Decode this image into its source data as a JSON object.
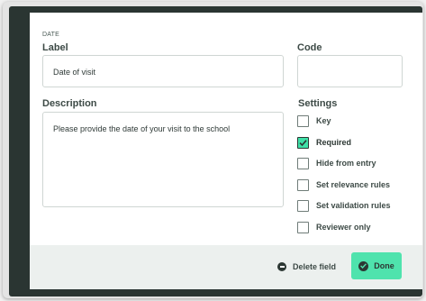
{
  "dialog": {
    "section_label": "DATE",
    "label": {
      "title": "Label",
      "value": "Date of visit"
    },
    "code": {
      "title": "Code",
      "value": ""
    },
    "description": {
      "title": "Description",
      "value": "Please provide the date of your visit to the school"
    },
    "settings": {
      "title": "Settings",
      "options": [
        {
          "label": "Key",
          "checked": false
        },
        {
          "label": "Required",
          "checked": true
        },
        {
          "label": "Hide from entry",
          "checked": false
        },
        {
          "label": "Set relevance rules",
          "checked": false
        },
        {
          "label": "Set validation rules",
          "checked": false
        },
        {
          "label": "Reviewer only",
          "checked": false
        }
      ]
    }
  },
  "footer": {
    "delete_label": "Delete field",
    "done_label": "Done"
  },
  "colors": {
    "backdrop": "#2a3532",
    "accent": "#4fe3ad",
    "footer": "#ecf0ee"
  }
}
